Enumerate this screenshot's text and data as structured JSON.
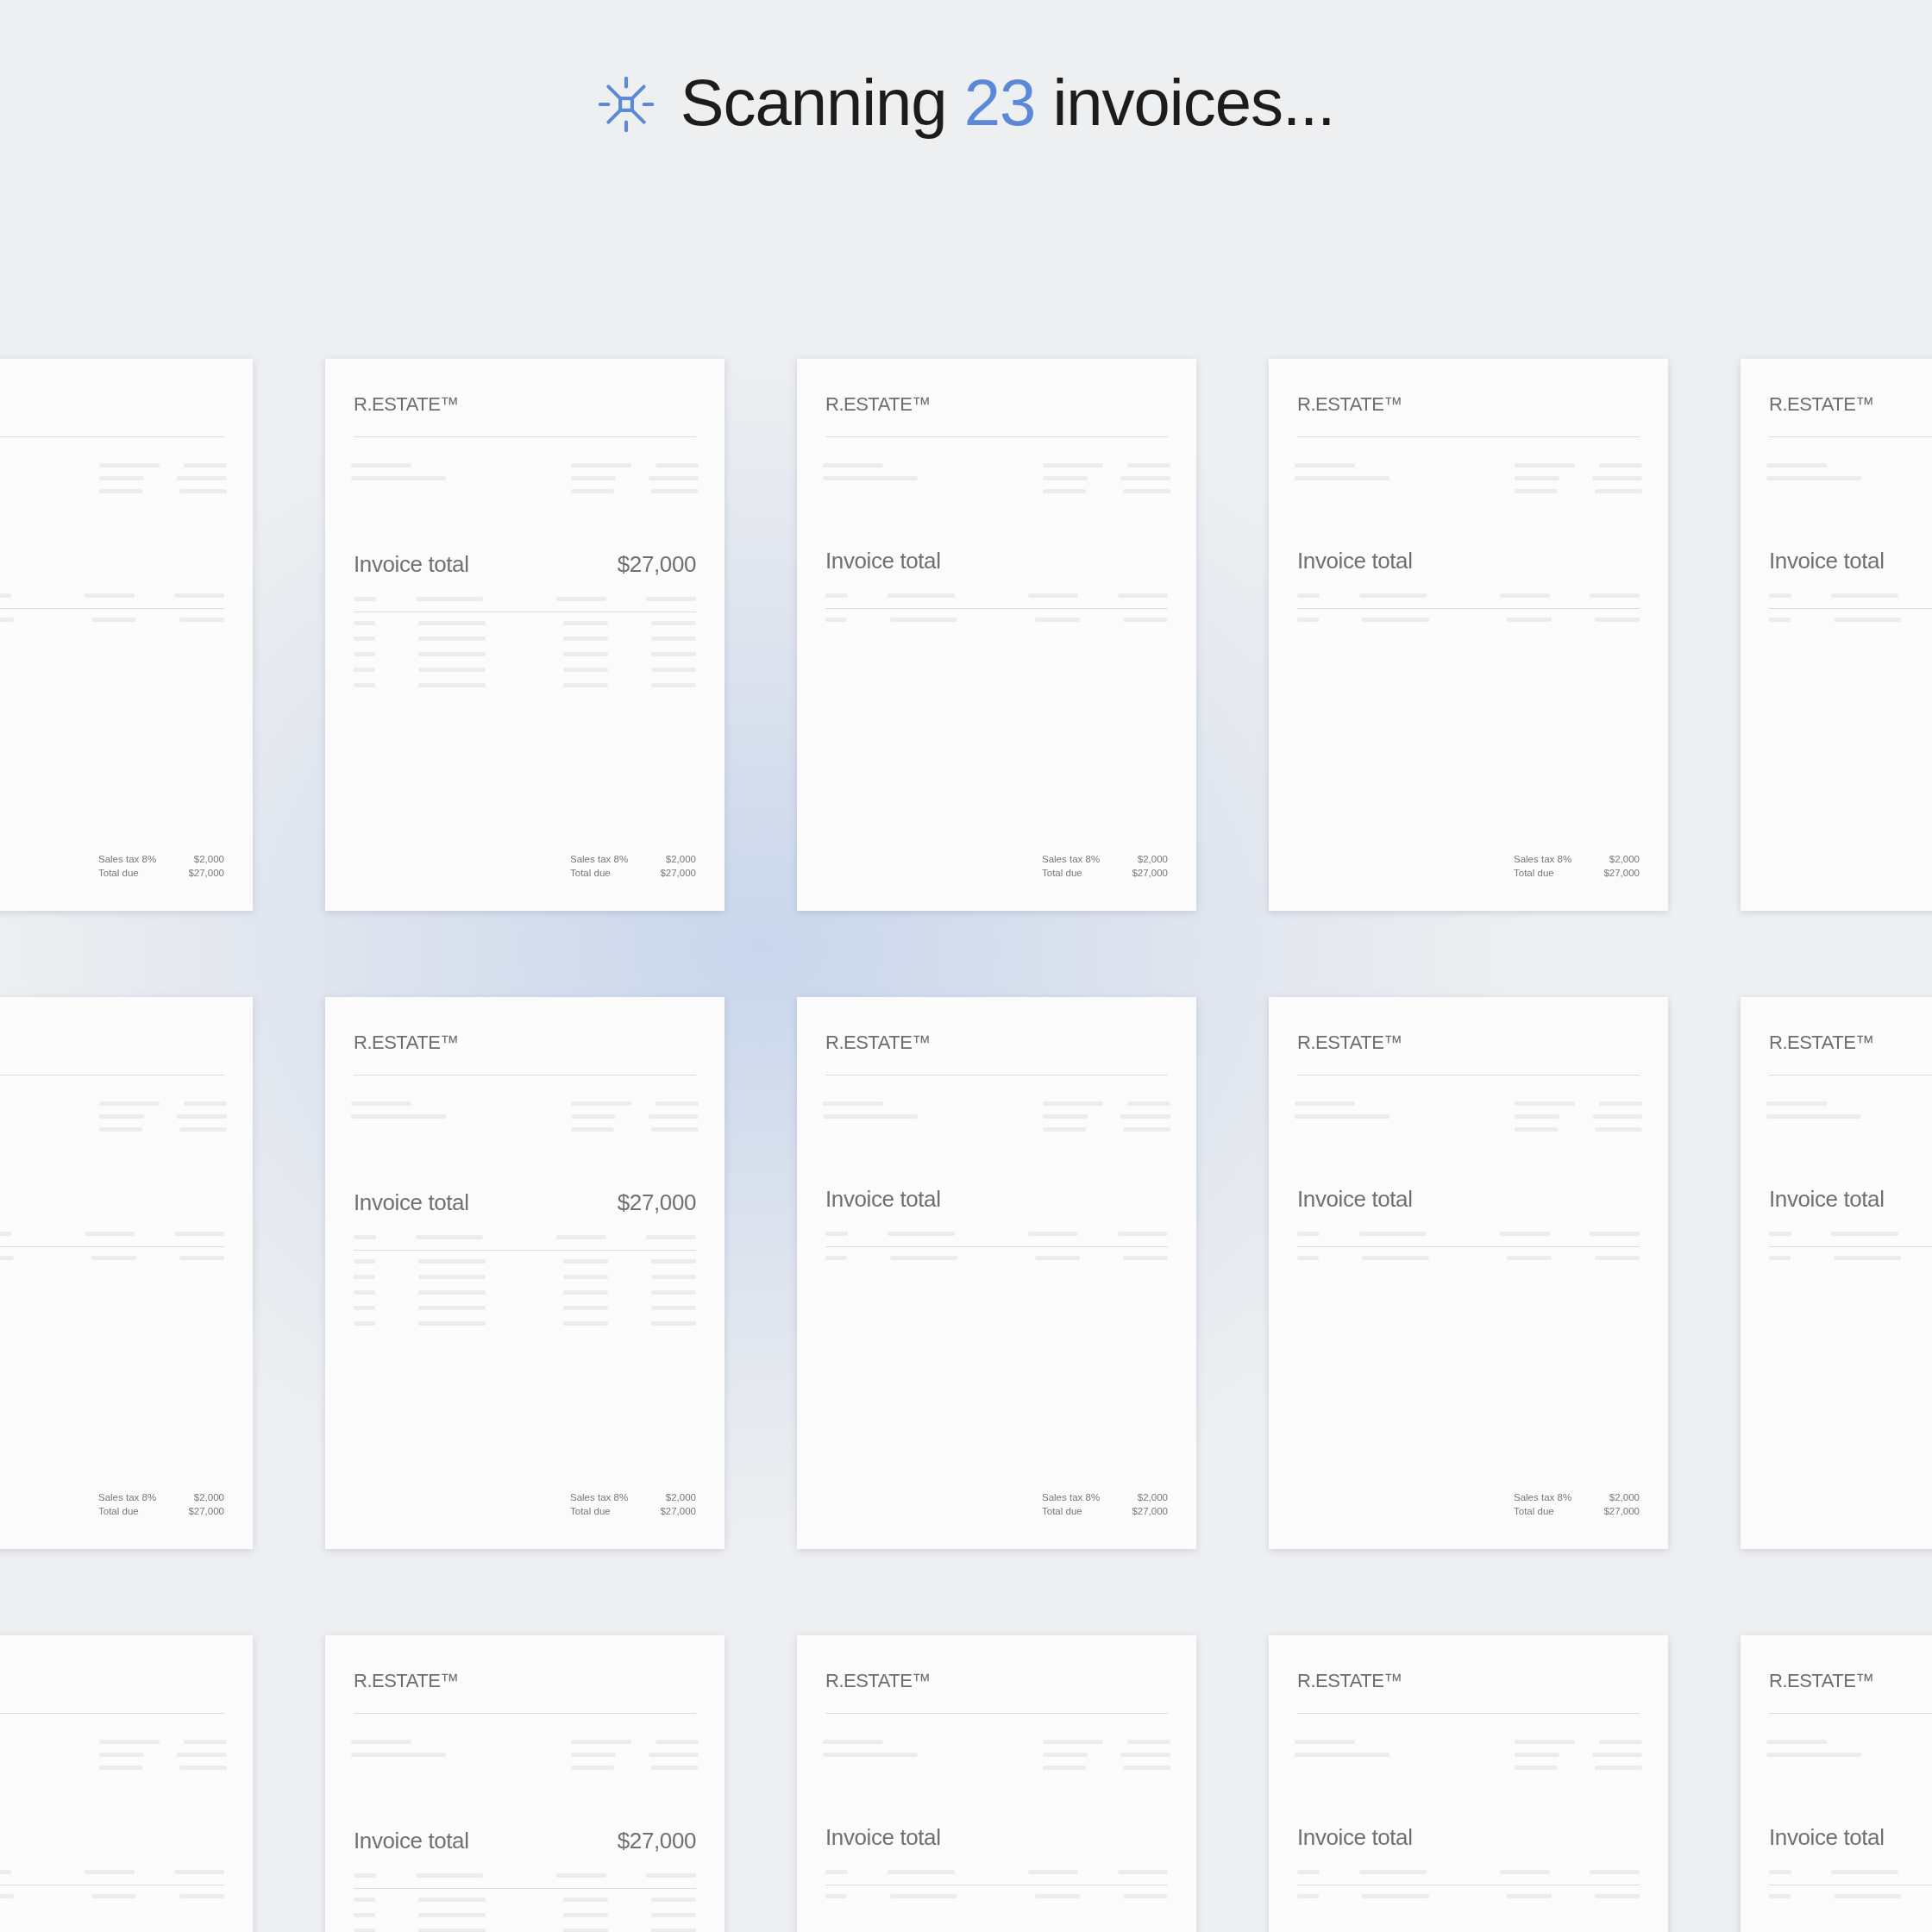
{
  "heading": {
    "before": "Scanning",
    "count": "23",
    "after": "invoices..."
  },
  "rows": [
    {
      "cards": [
        {
          "kind": "summary",
          "totals": [
            {
              "label": "Sales tax 8%",
              "value": "$2,000"
            },
            {
              "label": "Total due",
              "value": "$27,000"
            }
          ]
        },
        {
          "kind": "detailed",
          "logo": "R.ESTATE™",
          "title": "Invoice total",
          "amount": "$27,000",
          "totals": [
            {
              "label": "Sales tax 8%",
              "value": "$2,000"
            },
            {
              "label": "Total due",
              "value": "$27,000"
            }
          ]
        },
        {
          "kind": "summary",
          "logo": "R.ESTATE™",
          "title": "Invoice total",
          "totals": [
            {
              "label": "Sales tax 8%",
              "value": "$2,000"
            },
            {
              "label": "Total due",
              "value": "$27,000"
            }
          ]
        },
        {
          "kind": "summary",
          "logo": "R.ESTATE™",
          "title": "Invoice total",
          "totals": [
            {
              "label": "Sales tax 8%",
              "value": "$2,000"
            },
            {
              "label": "Total due",
              "value": "$27,000"
            }
          ]
        },
        {
          "kind": "summary",
          "logo": "R.ESTATE™",
          "title": "Invoice total"
        }
      ]
    },
    {
      "cards": [
        {
          "kind": "summary",
          "totals": [
            {
              "label": "Sales tax 8%",
              "value": "$2,000"
            },
            {
              "label": "Total due",
              "value": "$27,000"
            }
          ]
        },
        {
          "kind": "detailed",
          "logo": "R.ESTATE™",
          "title": "Invoice total",
          "amount": "$27,000",
          "totals": [
            {
              "label": "Sales tax 8%",
              "value": "$2,000"
            },
            {
              "label": "Total due",
              "value": "$27,000"
            }
          ]
        },
        {
          "kind": "summary",
          "logo": "R.ESTATE™",
          "title": "Invoice total",
          "totals": [
            {
              "label": "Sales tax 8%",
              "value": "$2,000"
            },
            {
              "label": "Total due",
              "value": "$27,000"
            }
          ]
        },
        {
          "kind": "summary",
          "logo": "R.ESTATE™",
          "title": "Invoice total",
          "totals": [
            {
              "label": "Sales tax 8%",
              "value": "$2,000"
            },
            {
              "label": "Total due",
              "value": "$27,000"
            }
          ]
        },
        {
          "kind": "summary",
          "logo": "R.ESTATE™",
          "title": "Invoice total"
        }
      ]
    },
    {
      "cards": [
        {
          "kind": "summary"
        },
        {
          "kind": "detailed",
          "logo": "R.ESTATE™",
          "title": "Invoice total",
          "amount": "$27,000"
        },
        {
          "kind": "summary",
          "logo": "R.ESTATE™",
          "title": "Invoice total"
        },
        {
          "kind": "summary",
          "logo": "R.ESTATE™",
          "title": "Invoice total"
        },
        {
          "kind": "summary",
          "logo": "R.ESTATE™",
          "title": "Invoice total"
        }
      ]
    }
  ]
}
